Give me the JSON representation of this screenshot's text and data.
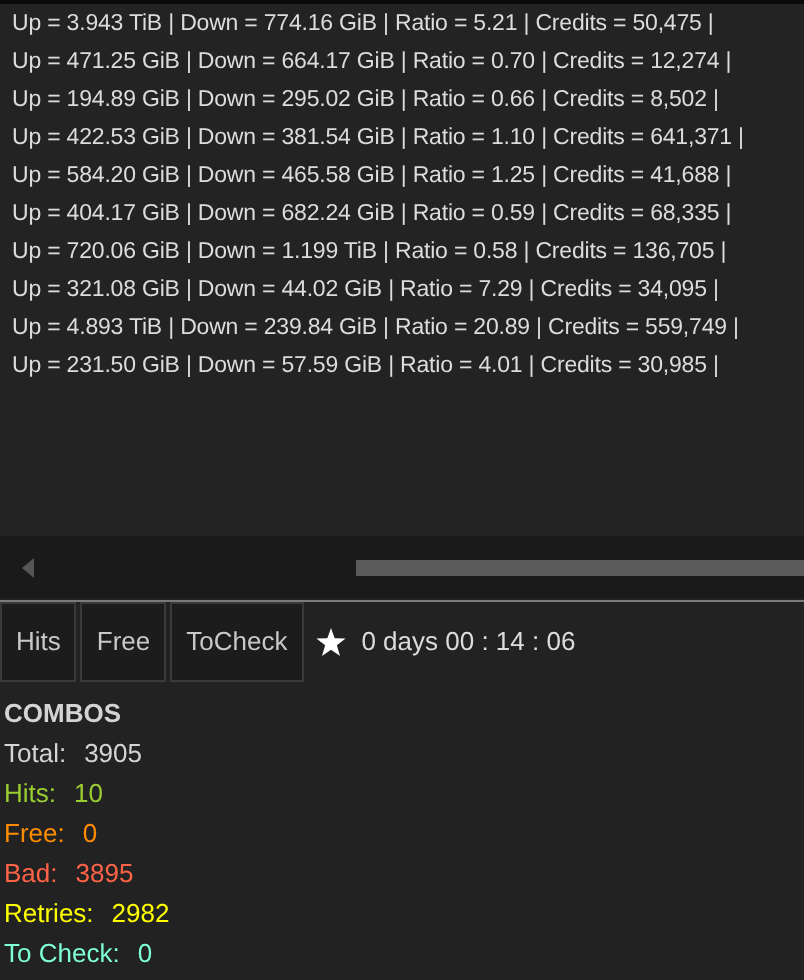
{
  "log_lines": [
    "Up = 3.943 TiB | Down = 774.16 GiB | Ratio = 5.21 | Credits = 50,475 |",
    "Up = 471.25 GiB | Down = 664.17 GiB | Ratio = 0.70 | Credits = 12,274 |",
    "Up = 194.89 GiB | Down = 295.02 GiB | Ratio = 0.66 | Credits = 8,502 |",
    "Up = 422.53 GiB | Down = 381.54 GiB | Ratio = 1.10 | Credits = 641,371 |",
    "Up = 584.20 GiB | Down = 465.58 GiB | Ratio = 1.25 | Credits = 41,688 |",
    "Up = 404.17 GiB | Down = 682.24 GiB | Ratio = 0.59 | Credits = 68,335 |",
    "Up = 720.06 GiB | Down = 1.199 TiB | Ratio = 0.58 | Credits = 136,705 |",
    "Up = 321.08 GiB | Down = 44.02 GiB | Ratio = 7.29 | Credits = 34,095 |",
    "Up = 4.893 TiB | Down = 239.84 GiB | Ratio = 20.89 | Credits = 559,749 |",
    "Up = 231.50 GiB | Down = 57.59 GiB | Ratio = 4.01 | Credits = 30,985 |"
  ],
  "buttons": [
    "Hits",
    "Free",
    "ToCheck"
  ],
  "elapsed": "0 days 00 : 14 : 06",
  "combos": {
    "title": "COMBOS",
    "stats": [
      {
        "label": "Total:",
        "value": "3905",
        "color": "#d4d4d4"
      },
      {
        "label": "Hits:",
        "value": "10",
        "color": "#9acd32"
      },
      {
        "label": "Free:",
        "value": "0",
        "color": "#ff8c00"
      },
      {
        "label": "Bad:",
        "value": "3895",
        "color": "#ff6347"
      },
      {
        "label": "Retries:",
        "value": "2982",
        "color": "#ffff00"
      },
      {
        "label": "To Check:",
        "value": "0",
        "color": "#7fffd4"
      }
    ]
  }
}
